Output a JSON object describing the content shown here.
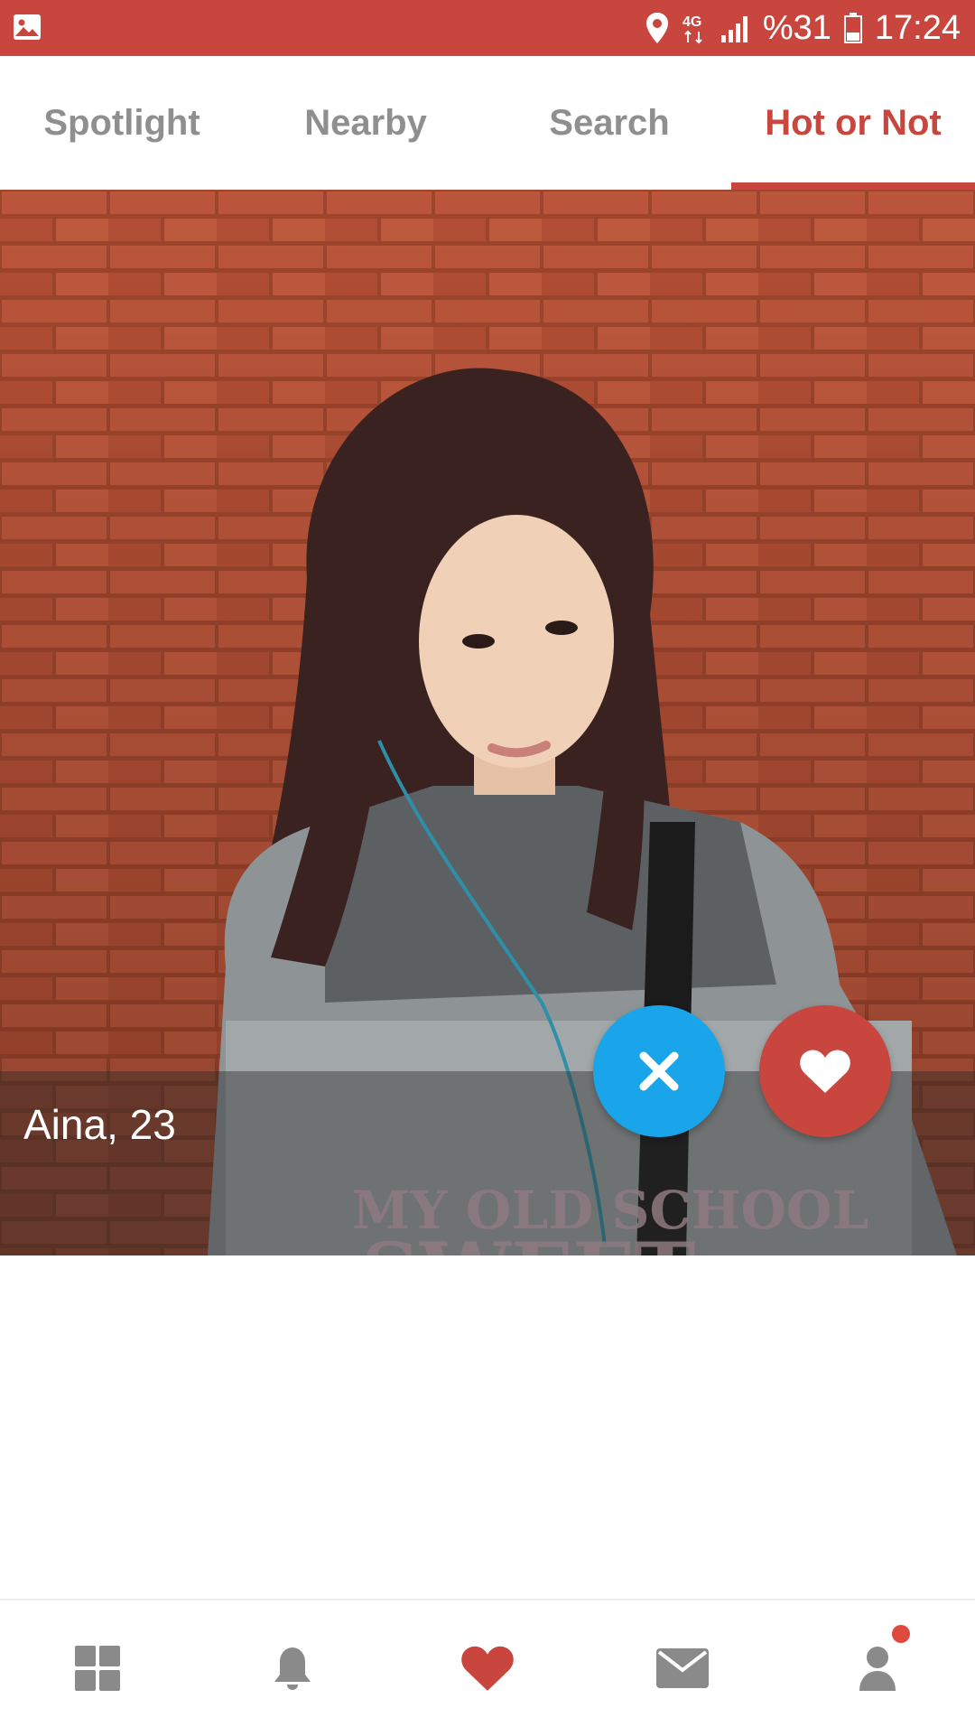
{
  "status_bar": {
    "battery_text": "%31",
    "time": "17:24",
    "network": "4G",
    "icons": [
      "gallery-icon",
      "location-icon",
      "signal-icon",
      "battery-icon"
    ]
  },
  "tabs": [
    {
      "label": "Spotlight",
      "active": false
    },
    {
      "label": "Nearby",
      "active": false
    },
    {
      "label": "Search",
      "active": false
    },
    {
      "label": "Hot or Not",
      "active": true
    }
  ],
  "profile": {
    "name_age": "Aina, 23"
  },
  "actions": {
    "nope_icon": "close-icon",
    "like_icon": "heart-icon"
  },
  "bottom_nav": [
    {
      "icon": "grid-icon",
      "active": false
    },
    {
      "icon": "bell-icon",
      "active": false
    },
    {
      "icon": "heart-icon",
      "active": true
    },
    {
      "icon": "mail-icon",
      "active": false
    },
    {
      "icon": "profile-icon",
      "active": false,
      "has_notification": true
    }
  ],
  "colors": {
    "accent": "#c8463d",
    "nope": "#1aa4ea",
    "inactive_tab": "#8f8f8f",
    "inactive_icon": "#8a8a8a"
  }
}
